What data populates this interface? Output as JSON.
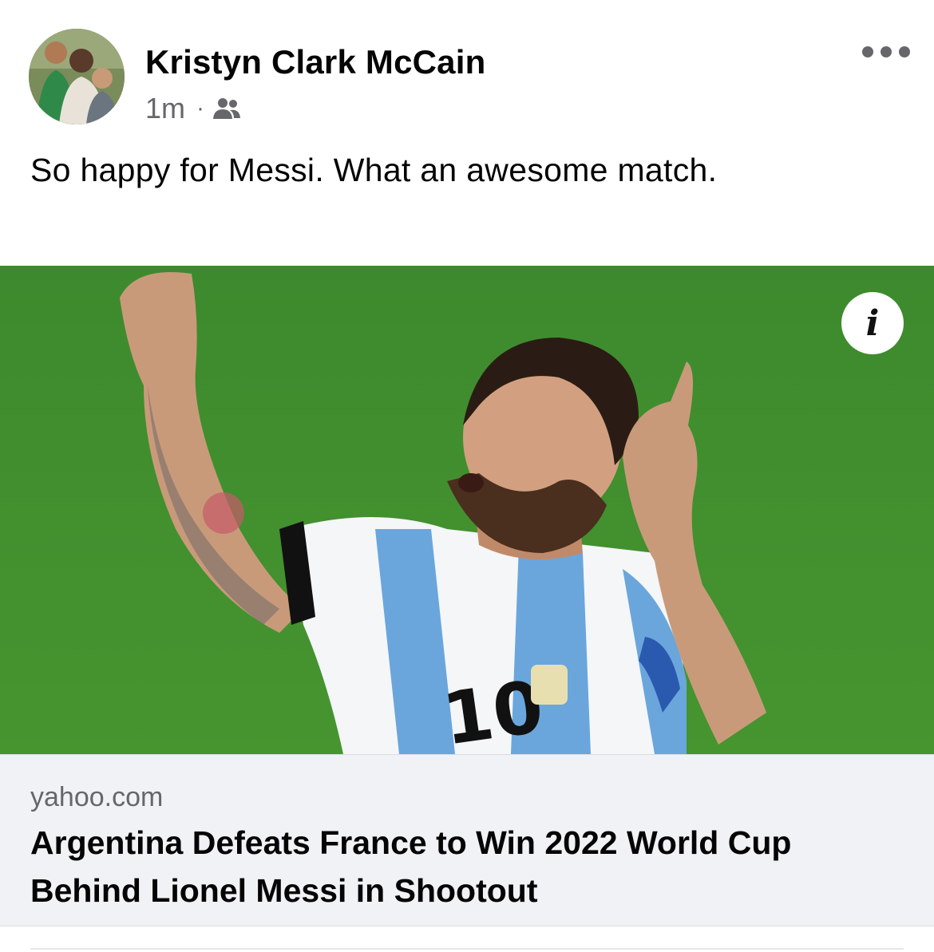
{
  "post": {
    "author": "Kristyn Clark McCain",
    "time": "1m",
    "separator": "·",
    "audience_icon": "friends-icon",
    "caption": "So happy for Messi. What an awesome match.",
    "more_icon": "more-options-icon"
  },
  "link": {
    "domain": "yahoo.com",
    "title": "Argentina Defeats France to Win 2022 World Cup Behind Lionel Messi in Shootout",
    "info_icon": "info-icon",
    "image_alt": "Lionel Messi pointing upward in Argentina jersey number 10",
    "jersey_number": "10"
  },
  "colors": {
    "text_primary": "#050505",
    "text_secondary": "#65676b",
    "preview_bg": "#f0f2f5",
    "pitch_green": "#3f8a2f",
    "jersey_blue": "#6aa6dc"
  }
}
